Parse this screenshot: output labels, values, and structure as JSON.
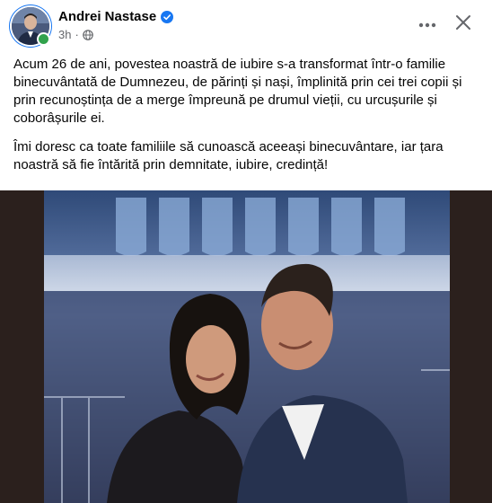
{
  "header": {
    "author": "Andrei Nastase",
    "time": "3h",
    "separator": "·",
    "avatar_icon": "profile-avatar",
    "verified_icon": "verified-badge",
    "audience_icon": "globe-icon",
    "more_icon": "more-horizontal-icon",
    "close_icon": "close-icon"
  },
  "post": {
    "paragraphs": [
      "Acum 26 de ani, povestea noastră de iubire s-a transformat într-o familie binecuvântată de Dumnezeu, de părinți și nași, împlinită prin cei trei copii și prin recunoștința de a merge împreună pe drumul vieții, cu urcușurile și coborâșurile ei.",
      "Îmi doresc ca toate familiile să cunoască aceeași binecuvântare, iar țara noastră să fie întărită prin demnitate, iubire, credință!"
    ]
  },
  "media": {
    "type": "photo"
  },
  "colors": {
    "brand_blue": "#1877f2",
    "online_green": "#31a24c",
    "secondary_text": "#65676b",
    "media_background": "#2b201d"
  }
}
